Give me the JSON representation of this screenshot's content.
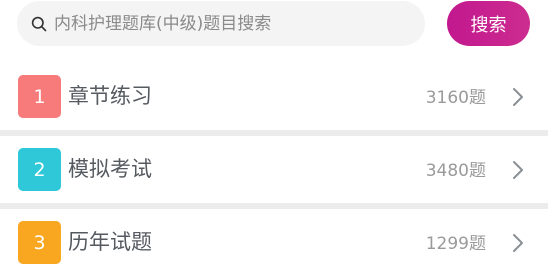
{
  "search": {
    "placeholder": "内科护理题库(中级)题目搜索",
    "button_label": "搜索",
    "icon": "search-icon"
  },
  "colors": {
    "search_button": "#c91e8f",
    "badge_1": "#f77b7b",
    "badge_2": "#2ec8d8",
    "badge_3": "#f9a620"
  },
  "sections": [
    {
      "number": "1",
      "title": "章节练习",
      "count": "3160题",
      "icon": "chevron-right-icon"
    },
    {
      "number": "2",
      "title": "模拟考试",
      "count": "3480题",
      "icon": "chevron-right-icon"
    },
    {
      "number": "3",
      "title": "历年试题",
      "count": "1299题",
      "icon": "chevron-right-icon"
    }
  ]
}
